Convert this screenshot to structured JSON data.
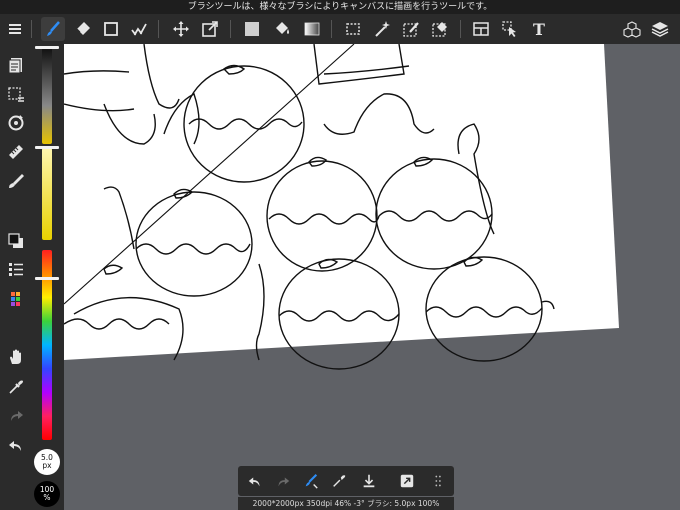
{
  "tip": "ブラシツールは、様々なブラシによりキャンバスに描画を行うツールです。",
  "brush": {
    "size_value": "5.0",
    "size_unit": "px",
    "opacity_value": "100",
    "opacity_unit": "%"
  },
  "status": "2000*2000px 350dpi 46% -3° ブラシ: 5.0px 100%",
  "toolbar": {
    "text_tool_glyph": "T"
  },
  "colors": {
    "bar_bg": "#2b2b2b",
    "canvas_bg": "#5f6166",
    "accent": "#2e8df5",
    "icon": "#e6e6e6"
  },
  "icons": {
    "top": [
      "menu-icon",
      "brush-icon",
      "eraser-icon",
      "rectangle-icon",
      "correction-brush-icon",
      "move-icon",
      "transform-icon",
      "fill-color-icon",
      "bucket-icon",
      "gradient-icon",
      "select-rect-icon",
      "magic-wand-icon",
      "select-pen-icon",
      "select-eraser-icon",
      "frame-divide-icon",
      "operation-icon",
      "text-icon",
      "materials-icon",
      "layers-icon"
    ],
    "left": [
      "pages-icon",
      "selection-icon",
      "rotate-icon",
      "ruler-icon",
      "eyedropper-brush-icon",
      "color-swatch-icon",
      "layer-list-icon",
      "palette-icon",
      "hand-icon",
      "eyedropper-icon",
      "redo-icon",
      "undo-icon"
    ],
    "bottom": [
      "undo-icon",
      "redo-icon",
      "brush-swap-icon",
      "eyedropper-icon",
      "save-icon",
      "transform-box-icon",
      "grid-icon"
    ]
  }
}
